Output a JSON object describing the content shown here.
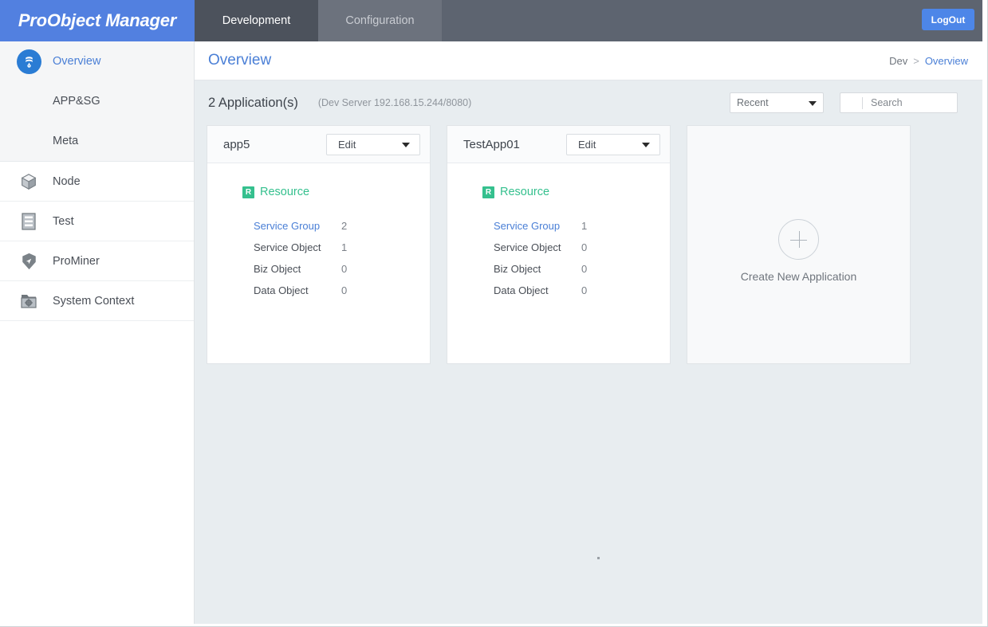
{
  "header": {
    "brand": "ProObject Manager",
    "tabs": [
      {
        "label": "Development",
        "active": true
      },
      {
        "label": "Configuration",
        "active": false
      }
    ],
    "logout_label": "LogOut",
    "brand_color": "#5280e0",
    "bar_color": "#5d6470",
    "logout_color": "#4d86e8"
  },
  "sidebar": {
    "group_items": [
      {
        "label": "Overview",
        "icon": "database-icon",
        "active": true
      },
      {
        "label": "APP&SG",
        "icon": "none",
        "active": false
      },
      {
        "label": "Meta",
        "icon": "none",
        "active": false
      }
    ],
    "items": [
      {
        "label": "Node",
        "icon": "cube-icon"
      },
      {
        "label": "Test",
        "icon": "document-lines-icon"
      },
      {
        "label": "ProMiner",
        "icon": "shield-arrow-icon"
      },
      {
        "label": "System Context",
        "icon": "folder-gear-icon"
      }
    ]
  },
  "page": {
    "title": "Overview",
    "breadcrumb": {
      "root": "Dev",
      "separator": ">",
      "current": "Overview"
    },
    "accent_color": "#4a7fd6"
  },
  "toolbar": {
    "app_count": "2 Application(s)",
    "server_info": "(Dev Server  192.168.15.244/8080)",
    "sort_select": {
      "value": "Recent"
    },
    "search": {
      "value": "",
      "placeholder": "Search"
    }
  },
  "cards": [
    {
      "title": "app5",
      "edit_label": "Edit",
      "resource_badge": "R",
      "resource_label": "Resource",
      "resource_color": "#35c08e",
      "rows": [
        {
          "name": "Service Group",
          "value": "2",
          "link": true
        },
        {
          "name": "Service Object",
          "value": "1",
          "link": false
        },
        {
          "name": "Biz Object",
          "value": "0",
          "link": false
        },
        {
          "name": "Data Object",
          "value": "0",
          "link": false
        }
      ]
    },
    {
      "title": "TestApp01",
      "edit_label": "Edit",
      "resource_badge": "R",
      "resource_label": "Resource",
      "resource_color": "#35c08e",
      "rows": [
        {
          "name": "Service Group",
          "value": "1",
          "link": true
        },
        {
          "name": "Service Object",
          "value": "0",
          "link": false
        },
        {
          "name": "Biz Object",
          "value": "0",
          "link": false
        },
        {
          "name": "Data Object",
          "value": "0",
          "link": false
        }
      ]
    }
  ],
  "create_card": {
    "label": "Create New Application",
    "icon": "plus-circle-icon"
  }
}
